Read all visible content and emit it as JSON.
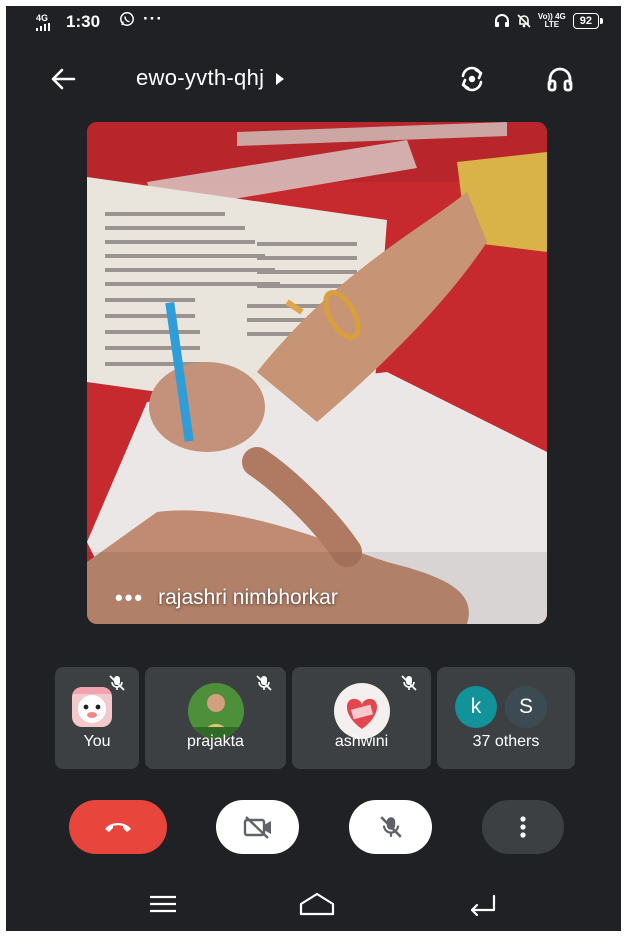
{
  "status_bar": {
    "network": "4G",
    "time": "1:30",
    "volte": "Vo)) 4G",
    "lte": "LTE",
    "battery": "92"
  },
  "header": {
    "meeting_code": "ewo-yvth-qhj"
  },
  "main_video": {
    "speaker_name": "rajashri nimbhorkar",
    "more_label": "•••"
  },
  "participants": [
    {
      "name": "You",
      "muted": true
    },
    {
      "name": "prajakta",
      "muted": true
    },
    {
      "name": "ashwini",
      "muted": true
    },
    {
      "name": "37 others",
      "avatars": [
        "k",
        "S"
      ]
    }
  ],
  "colors": {
    "background": "#202124",
    "tile": "#3c4043",
    "end_call": "#e8453c",
    "avatar_k": "#12939a",
    "avatar_s": "#3c4b52"
  },
  "icons": {
    "back": "arrow-left-icon",
    "switch_camera": "switch-camera-icon",
    "audio": "headphones-icon",
    "end_call": "phone-hangup-icon",
    "camera": "video-off-icon",
    "mic": "mic-off-icon",
    "more": "more-vert-icon"
  }
}
